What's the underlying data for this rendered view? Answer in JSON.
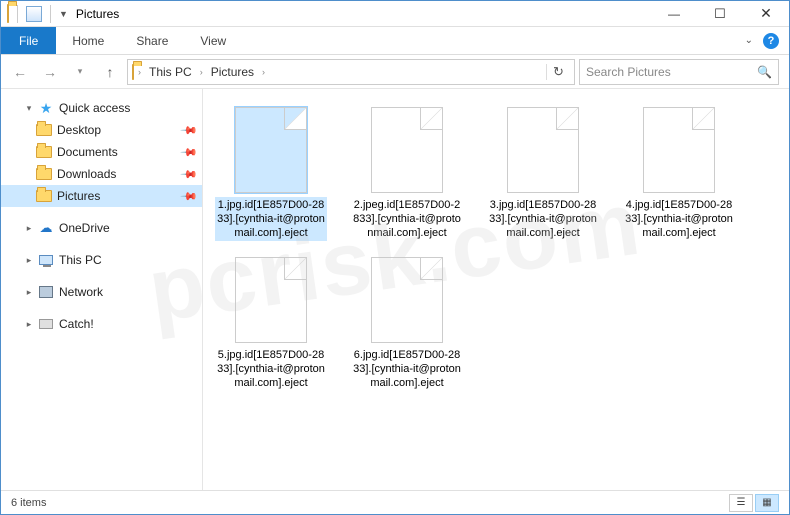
{
  "window": {
    "title": "Pictures"
  },
  "ribbon": {
    "file": "File",
    "tabs": [
      "Home",
      "Share",
      "View"
    ]
  },
  "breadcrumbs": [
    "This PC",
    "Pictures"
  ],
  "search": {
    "placeholder": "Search Pictures"
  },
  "nav": {
    "quick_access": {
      "label": "Quick access"
    },
    "qa_items": [
      {
        "label": "Desktop"
      },
      {
        "label": "Documents"
      },
      {
        "label": "Downloads"
      },
      {
        "label": "Pictures"
      }
    ],
    "onedrive": "OneDrive",
    "thispc": "This PC",
    "network": "Network",
    "catch": "Catch!"
  },
  "files": [
    {
      "name": "1.jpg.id[1E857D00-2833].[cynthia-it@protonmail.com].eject"
    },
    {
      "name": "2.jpeg.id[1E857D00-2833].[cynthia-it@protonmail.com].eject"
    },
    {
      "name": "3.jpg.id[1E857D00-2833].[cynthia-it@protonmail.com].eject"
    },
    {
      "name": "4.jpg.id[1E857D00-2833].[cynthia-it@protonmail.com].eject"
    },
    {
      "name": "5.jpg.id[1E857D00-2833].[cynthia-it@protonmail.com].eject"
    },
    {
      "name": "6.jpg.id[1E857D00-2833].[cynthia-it@protonmail.com].eject"
    }
  ],
  "status": {
    "count": "6 items"
  },
  "watermark": "pcrisk.com"
}
